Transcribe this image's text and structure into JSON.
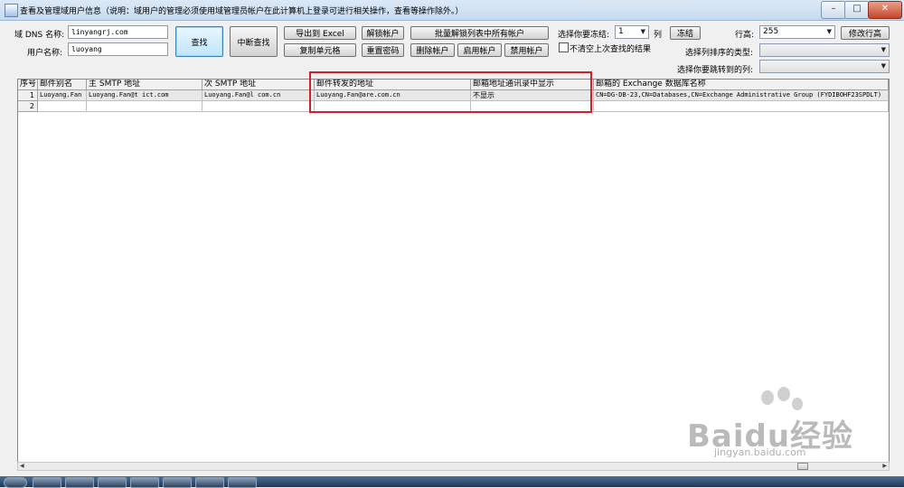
{
  "window": {
    "title": "查看及管理域用户信息（说明：域用户的管理必须使用域管理员帐户在此计算机上登录可进行相关操作，查看等操作除外。）",
    "minimize": "–",
    "maximize": "□",
    "close": "✕"
  },
  "form": {
    "dns_label": "域 DNS 名称:",
    "dns_value": "linyangrj.com",
    "user_label": "用户名称:",
    "user_value": "luoyang",
    "freeze_label": "选择你要冻结:",
    "freeze_value": "1",
    "col_unit": "列",
    "row_height_label": "行高:",
    "row_height_value": "255",
    "sort_label": "选择列排序的类型:",
    "sort_value": "",
    "jump_label": "选择你要跳转到的列:",
    "jump_value": "",
    "keep_results_label": "不清空上次查找的结果"
  },
  "buttons": {
    "search": "查找",
    "stop_search": "中断查找",
    "export_excel": "导出到 Excel",
    "copy_cell": "复制单元格",
    "unlock": "解锁帐户",
    "reset_pwd": "重置密码",
    "batch_unlock": "批量解锁列表中所有帐户",
    "delete_account": "删除帐户",
    "enable_account": "启用帐户",
    "disable_account": "禁用帐户",
    "freeze": "冻结",
    "edit_row_height": "修改行高"
  },
  "grid": {
    "headers": [
      "序号",
      "邮件别名",
      "主 SMTP 地址",
      "次 SMTP 地址",
      "邮件转发的地址",
      "邮箱地址通讯录中显示",
      "邮箱的 Exchange 数据库名称"
    ],
    "rows": [
      {
        "no": "1",
        "alias": "Luoyang.Fan",
        "primary_smtp": "Luoyang.Fan@t        ict.com",
        "secondary_smtp": "Luoyang.Fan@l          com.cn",
        "forward": "Luoyang.Fan@are.com.cn",
        "show_in_gal": "不显示",
        "db": "CN=DG-DB-23,CN=Databases,CN=Exchange Administrative Group (FYDIBOHF23SPDLT)"
      },
      {
        "no": "2",
        "alias": "",
        "primary_smtp": "",
        "secondary_smtp": "",
        "forward": "",
        "show_in_gal": "",
        "db": ""
      }
    ]
  },
  "watermark": {
    "brand": "Baidu经验",
    "url": "jingyan.baidu.com"
  },
  "colors": {
    "highlight_box": "#d0202a",
    "title_bar": "#c6dbf0"
  }
}
